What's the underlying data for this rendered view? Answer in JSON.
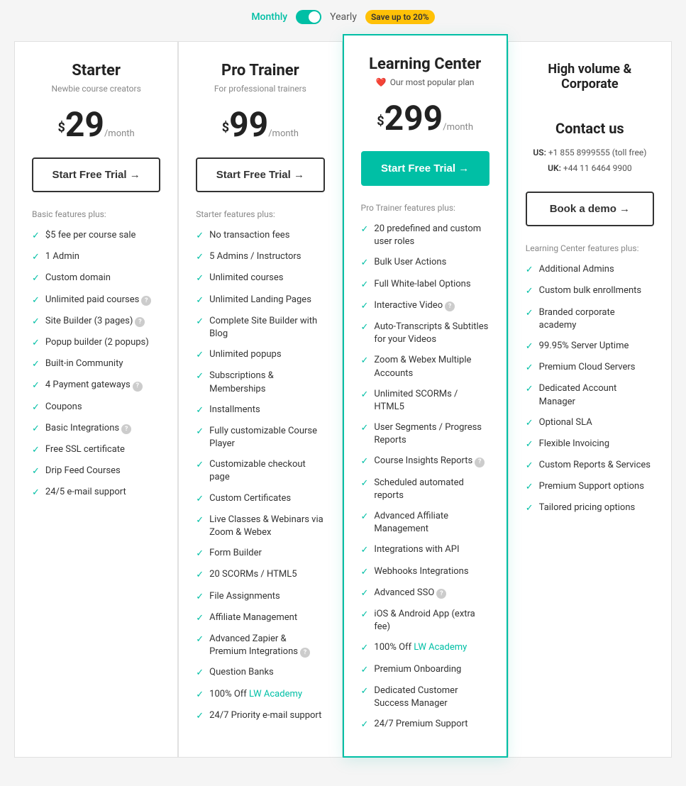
{
  "header": {
    "monthly_label": "Monthly",
    "yearly_label": "Yearly",
    "save_badge": "Save up to 20%"
  },
  "plans": [
    {
      "id": "starter",
      "name": "Starter",
      "subtitle": "Newbie course creators",
      "price_dollar": "$",
      "price_amount": "29",
      "price_period": "/month",
      "cta_label": "Start Free Trial →",
      "cta_type": "outline",
      "features_heading": "Basic features plus:",
      "features": [
        {
          "text": "$5 fee per course sale",
          "has_info": false
        },
        {
          "text": "1 Admin",
          "has_info": false
        },
        {
          "text": "Custom domain",
          "has_info": false
        },
        {
          "text": "Unlimited paid courses",
          "has_info": true
        },
        {
          "text": "Site Builder (3 pages)",
          "has_info": true
        },
        {
          "text": "Popup builder (2 popups)",
          "has_info": false
        },
        {
          "text": "Built-in Community",
          "has_info": false
        },
        {
          "text": "4 Payment gateways",
          "has_info": true
        },
        {
          "text": "Coupons",
          "has_info": false
        },
        {
          "text": "Basic Integrations",
          "has_info": true
        },
        {
          "text": "Free SSL certificate",
          "has_info": false
        },
        {
          "text": "Drip Feed Courses",
          "has_info": false
        },
        {
          "text": "24/5 e-mail support",
          "has_info": false
        }
      ]
    },
    {
      "id": "pro-trainer",
      "name": "Pro Trainer",
      "subtitle": "For professional trainers",
      "price_dollar": "$",
      "price_amount": "99",
      "price_period": "/month",
      "cta_label": "Start Free Trial →",
      "cta_type": "outline",
      "features_heading": "Starter features plus:",
      "features": [
        {
          "text": "No transaction fees",
          "has_info": false
        },
        {
          "text": "5 Admins / Instructors",
          "has_info": false
        },
        {
          "text": "Unlimited courses",
          "has_info": false
        },
        {
          "text": "Unlimited Landing Pages",
          "has_info": false
        },
        {
          "text": "Complete Site Builder with Blog",
          "has_info": false
        },
        {
          "text": "Unlimited popups",
          "has_info": false
        },
        {
          "text": "Subscriptions & Memberships",
          "has_info": false
        },
        {
          "text": "Installments",
          "has_info": false
        },
        {
          "text": "Fully customizable Course Player",
          "has_info": false
        },
        {
          "text": "Customizable checkout page",
          "has_info": false
        },
        {
          "text": "Custom Certificates",
          "has_info": false
        },
        {
          "text": "Live Classes & Webinars via Zoom & Webex",
          "has_info": false
        },
        {
          "text": "Form Builder",
          "has_info": false
        },
        {
          "text": "20 SCORMs / HTML5",
          "has_info": false
        },
        {
          "text": "File Assignments",
          "has_info": false
        },
        {
          "text": "Affiliate Management",
          "has_info": false
        },
        {
          "text": "Advanced Zapier & Premium Integrations",
          "has_info": true
        },
        {
          "text": "Question Banks",
          "has_info": false
        },
        {
          "text": "100% Off LW Academy",
          "has_info": false,
          "has_link": true
        },
        {
          "text": "24/7 Priority e-mail support",
          "has_info": false
        }
      ]
    },
    {
      "id": "learning-center",
      "name": "Learning Center",
      "subtitle": "",
      "popular_text": "Our most popular plan",
      "price_dollar": "$",
      "price_amount": "299",
      "price_period": "/month",
      "cta_label": "Start Free Trial →",
      "cta_type": "filled",
      "features_heading": "Pro Trainer features plus:",
      "features": [
        {
          "text": "20 predefined and custom user roles",
          "has_info": false
        },
        {
          "text": "Bulk User Actions",
          "has_info": false
        },
        {
          "text": "Full White-label Options",
          "has_info": false
        },
        {
          "text": "Interactive Video",
          "has_info": true
        },
        {
          "text": "Auto-Transcripts & Subtitles for your Videos",
          "has_info": false
        },
        {
          "text": "Zoom & Webex Multiple Accounts",
          "has_info": false
        },
        {
          "text": "Unlimited SCORMs / HTML5",
          "has_info": false
        },
        {
          "text": "User Segments / Progress Reports",
          "has_info": false
        },
        {
          "text": "Course Insights Reports",
          "has_info": true
        },
        {
          "text": "Scheduled automated reports",
          "has_info": false
        },
        {
          "text": "Advanced Affiliate Management",
          "has_info": false
        },
        {
          "text": "Integrations with API",
          "has_info": false
        },
        {
          "text": "Webhooks Integrations",
          "has_info": false
        },
        {
          "text": "Advanced SSO",
          "has_info": true
        },
        {
          "text": "iOS & Android App (extra fee)",
          "has_info": false
        },
        {
          "text": "100% Off LW Academy",
          "has_info": false,
          "has_link": true
        },
        {
          "text": "Premium Onboarding",
          "has_info": false
        },
        {
          "text": "Dedicated Customer Success Manager",
          "has_info": false
        },
        {
          "text": "24/7 Premium Support",
          "has_info": false
        }
      ]
    },
    {
      "id": "high-volume",
      "name": "High volume & Corporate",
      "subtitle": "",
      "contact_us_label": "Contact us",
      "contact_us_label2": "Contact us",
      "phone_us_label": "US:",
      "phone_us": "+1 855 8999555 (toll free)",
      "phone_uk_label": "UK:",
      "phone_uk": "+44 11 6464 9900",
      "cta_label": "Book a demo →",
      "cta_type": "outline",
      "features_heading": "Learning Center features plus:",
      "features": [
        {
          "text": "Additional Admins",
          "has_info": false
        },
        {
          "text": "Custom bulk enrollments",
          "has_info": false
        },
        {
          "text": "Branded corporate academy",
          "has_info": false
        },
        {
          "text": "99.95% Server Uptime",
          "has_info": false
        },
        {
          "text": "Premium Cloud Servers",
          "has_info": false
        },
        {
          "text": "Dedicated Account Manager",
          "has_info": false
        },
        {
          "text": "Optional SLA",
          "has_info": false
        },
        {
          "text": "Flexible Invoicing",
          "has_info": false
        },
        {
          "text": "Custom Reports & Services",
          "has_info": false
        },
        {
          "text": "Premium Support options",
          "has_info": false
        },
        {
          "text": "Tailored pricing options",
          "has_info": false
        }
      ]
    }
  ]
}
